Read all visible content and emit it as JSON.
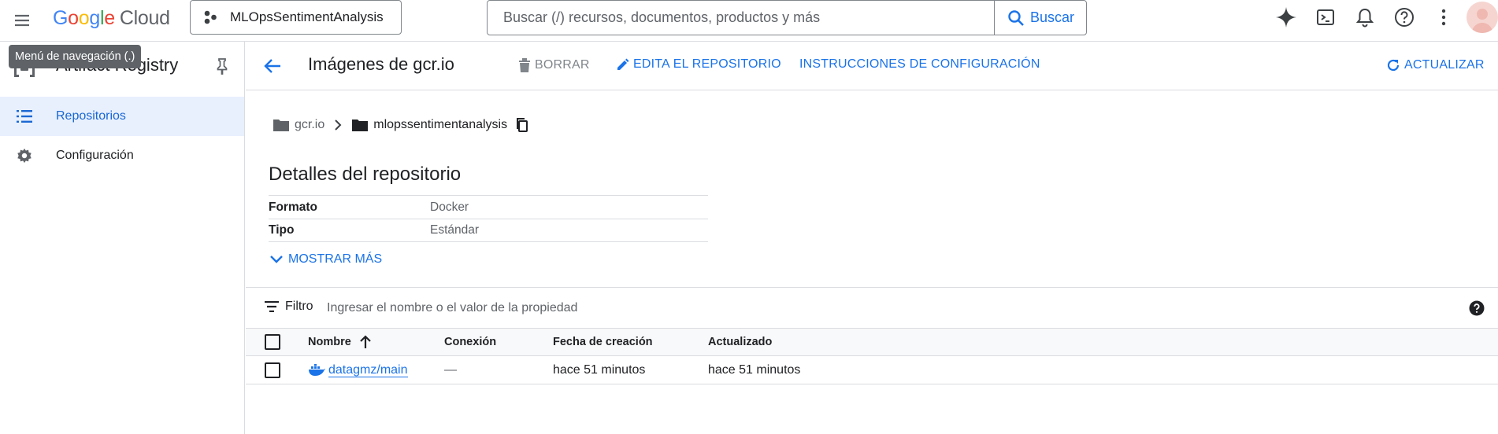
{
  "topbar": {
    "logo_google": [
      "G",
      "o",
      "o",
      "g",
      "l",
      "e"
    ],
    "logo_cloud": "Cloud",
    "project_name": "MLOpsSentimentAnalysis",
    "search_placeholder": "Buscar (/) recursos, documentos, productos y más",
    "search_button": "Buscar",
    "icons": [
      "gemini-sparkle-icon",
      "cloud-shell-icon",
      "bell-icon",
      "help-icon",
      "more-vert-icon"
    ]
  },
  "tooltip": "Menú de navegación (.)",
  "sidebar": {
    "product_title": "Artifact Registry",
    "items": [
      {
        "label": "Repositorios",
        "icon": "list-icon",
        "active": true
      },
      {
        "label": "Configuración",
        "icon": "gear-icon",
        "active": false
      }
    ]
  },
  "header": {
    "title": "Imágenes de gcr.io",
    "delete": "BORRAR",
    "edit": "EDITA EL REPOSITORIO",
    "setup": "INSTRUCCIONES DE CONFIGURACIÓN",
    "refresh": "ACTUALIZAR"
  },
  "breadcrumb": {
    "root": "gcr.io",
    "repo": "mlopssentimentanalysis"
  },
  "details": {
    "title": "Detalles del repositorio",
    "rows": [
      {
        "key": "Formato",
        "value": "Docker"
      },
      {
        "key": "Tipo",
        "value": "Estándar"
      }
    ],
    "show_more": "MOSTRAR MÁS"
  },
  "filter": {
    "label": "Filtro",
    "placeholder": "Ingresar el nombre o el valor de la propiedad"
  },
  "table": {
    "columns": [
      "Nombre",
      "Conexión",
      "Fecha de creación",
      "Actualizado"
    ],
    "sort_column": "Nombre",
    "sort_direction": "ascending",
    "rows": [
      {
        "name": "datagmz/main",
        "connection": "—",
        "created": "hace 51 minutos",
        "updated": "hace 51 minutos"
      }
    ]
  },
  "colors": {
    "accent": "#1a73e8",
    "active_bg": "#e8f0fe",
    "border": "#dadce0",
    "muted_text": "#5f6368"
  }
}
